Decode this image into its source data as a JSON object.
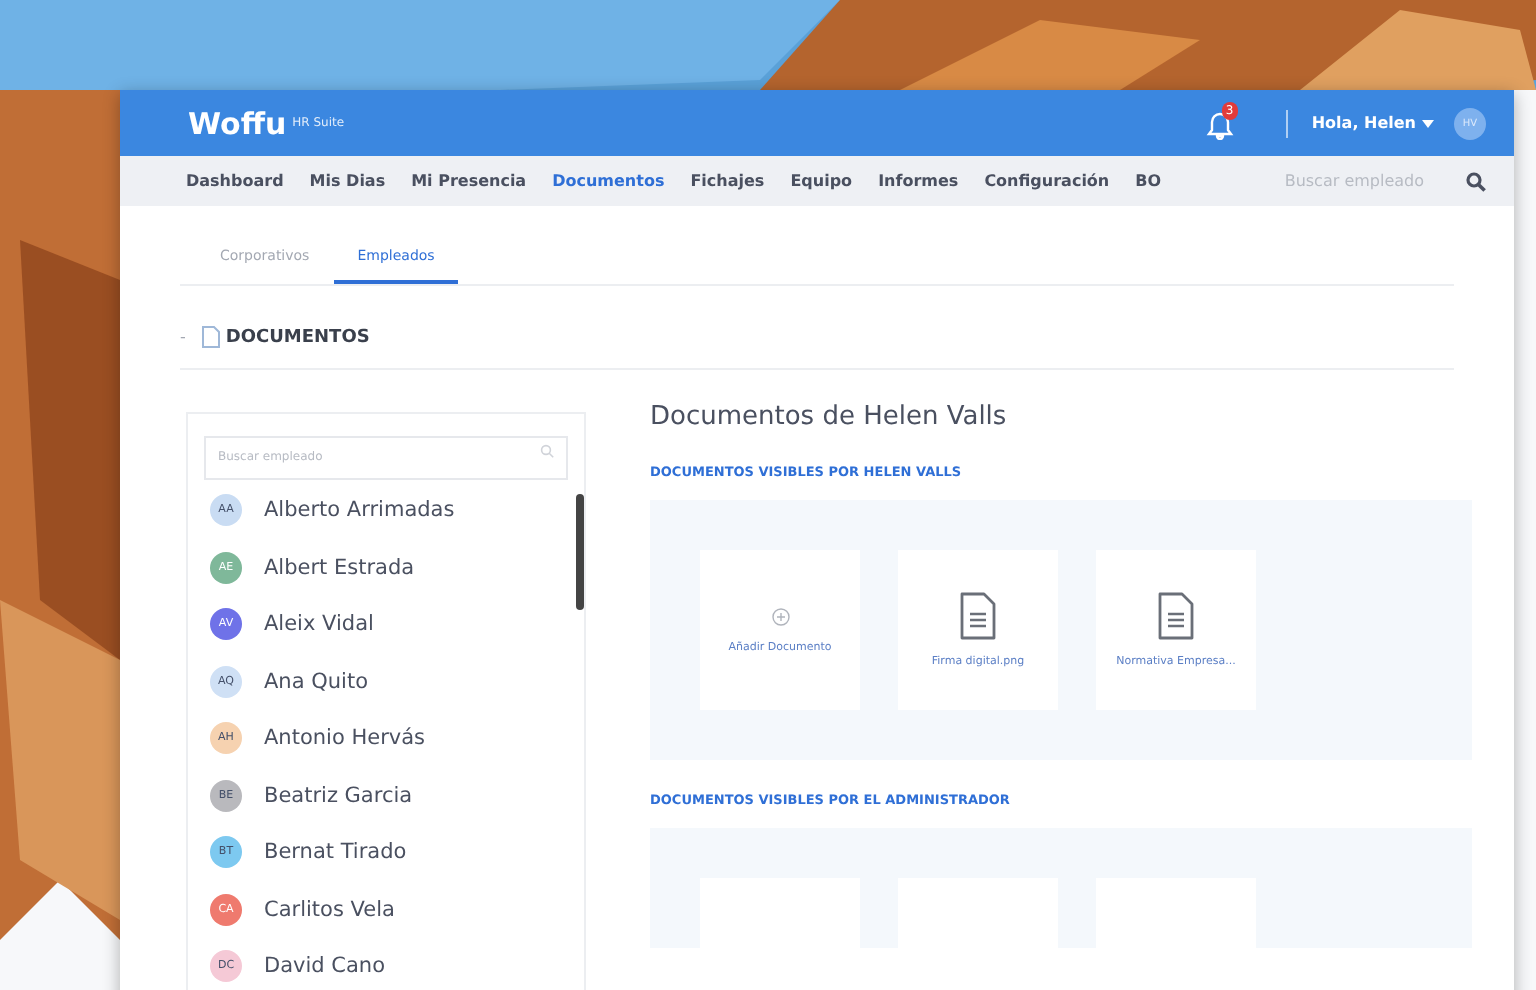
{
  "header": {
    "logo": "Woffu",
    "logo_suffix": "HR Suite",
    "notification_count": "3",
    "greeting": "Hola, Helen",
    "avatar_initials": "HV"
  },
  "nav": {
    "items": [
      {
        "label": "Dashboard",
        "selected": false
      },
      {
        "label": "Mis Dias",
        "selected": false
      },
      {
        "label": "Mi Presencia",
        "selected": false
      },
      {
        "label": "Documentos",
        "selected": true
      },
      {
        "label": "Fichajes",
        "selected": false
      },
      {
        "label": "Equipo",
        "selected": false
      },
      {
        "label": "Informes",
        "selected": false
      },
      {
        "label": "Configuración",
        "selected": false
      },
      {
        "label": "BO",
        "selected": false
      }
    ],
    "search_placeholder": "Buscar empleado"
  },
  "tabs": [
    {
      "label": "Corporativos",
      "selected": false
    },
    {
      "label": "Empleados",
      "selected": true
    }
  ],
  "section": {
    "toggle": "-",
    "title": "DOCUMENTOS"
  },
  "employees": {
    "search_placeholder": "Buscar empleado",
    "items": [
      {
        "initials": "AA",
        "name": "Alberto Arrimadas",
        "color": "#c9dcf3"
      },
      {
        "initials": "AE",
        "name": "Albert Estrada",
        "color": "#7fb89a"
      },
      {
        "initials": "AV",
        "name": "Aleix Vidal",
        "color": "#6f72e8"
      },
      {
        "initials": "AQ",
        "name": "Ana Quito",
        "color": "#cfe0f5"
      },
      {
        "initials": "AH",
        "name": "Antonio Hervás",
        "color": "#f6d2b0"
      },
      {
        "initials": "BE",
        "name": "Beatriz Garcia",
        "color": "#b9b9bd"
      },
      {
        "initials": "BT",
        "name": "Bernat Tirado",
        "color": "#7dc9f0"
      },
      {
        "initials": "CA",
        "name": "Carlitos Vela",
        "color": "#ef7a6e"
      },
      {
        "initials": "DC",
        "name": "David Cano",
        "color": "#f5c9d6"
      }
    ]
  },
  "content": {
    "title": "Documentos de Helen Valls",
    "groups": [
      {
        "heading": "DOCUMENTOS VISIBLES POR HELEN VALLS",
        "cards": [
          {
            "kind": "add",
            "label": "Añadir Documento"
          },
          {
            "kind": "file",
            "label": "Firma digital.png"
          },
          {
            "kind": "file",
            "label": "Normativa Empresa..."
          }
        ]
      },
      {
        "heading": "DOCUMENTOS VISIBLES POR EL ADMINISTRADOR",
        "cards": [
          {
            "kind": "blank"
          },
          {
            "kind": "blank"
          },
          {
            "kind": "blank"
          }
        ]
      }
    ]
  }
}
